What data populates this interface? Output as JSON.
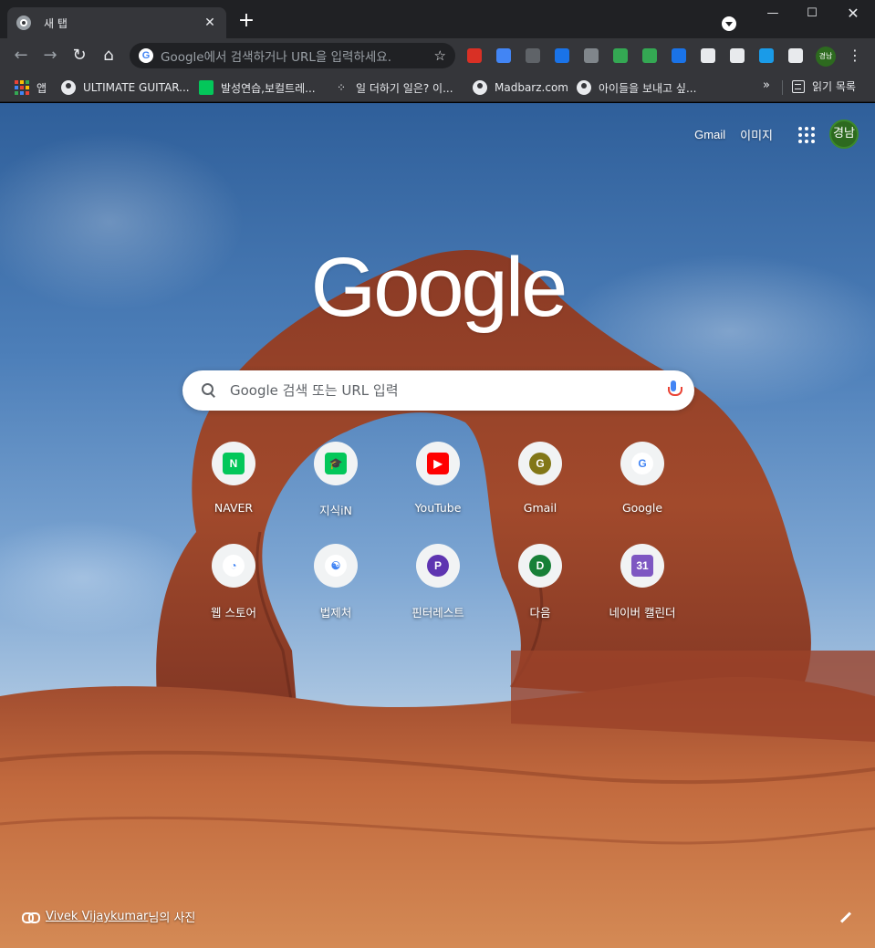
{
  "tab": {
    "title": "새 탭",
    "close": "✕",
    "new_tab": "+"
  },
  "window": {
    "minimize": "—",
    "maximize": "☐",
    "close": "✕"
  },
  "toolbar": {
    "back": "←",
    "forward": "→",
    "reload": "↻",
    "home": "⌂",
    "omnibox_placeholder": "Google에서 검색하거나 URL을 입력하세요.",
    "bookmark_star": "☆",
    "profile_label": "경남",
    "menu": "⋮",
    "extensions": [
      {
        "name": "adblock-extension",
        "color": "#d93025"
      },
      {
        "name": "translate-extension",
        "color": "#4285f4"
      },
      {
        "name": "ublock-extension",
        "color": "#5f6368"
      },
      {
        "name": "download-extension",
        "color": "#1a73e8"
      },
      {
        "name": "fx-extension",
        "color": "#80868b"
      },
      {
        "name": "check-extension",
        "color": "#34a853"
      },
      {
        "name": "screenshot-extension",
        "color": "#34a853"
      },
      {
        "name": "c-extension",
        "color": "#1a73e8"
      },
      {
        "name": "mail-extension",
        "color": "#e8eaed"
      },
      {
        "name": "ghost-extension",
        "color": "#e8eaed"
      },
      {
        "name": "todo-extension",
        "color": "#1a9be8"
      },
      {
        "name": "puzzle-extension",
        "color": "#e8eaed"
      }
    ]
  },
  "bookmarks": {
    "items": [
      {
        "label": "앱"
      },
      {
        "label": "ULTIMATE GUITAR..."
      },
      {
        "label": "발성연습,보컬트레..."
      },
      {
        "label": "일 더하기 일은? 이..."
      },
      {
        "label": "Madbarz.com"
      },
      {
        "label": "아이들을 보내고 싶..."
      }
    ],
    "overflow": "»",
    "reading_list": "읽기 목록"
  },
  "ntp": {
    "gmail": "Gmail",
    "images": "이미지",
    "avatar": "경남",
    "logo": "Google",
    "search_placeholder": "Google 검색 또는 URL 입력",
    "shortcuts": [
      {
        "label": "NAVER",
        "glyph": "N",
        "color": "#03c75a"
      },
      {
        "label": "지식iN",
        "glyph": "🎓",
        "color": "#03c75a"
      },
      {
        "label": "YouTube",
        "glyph": "▶",
        "color": "#ff0000"
      },
      {
        "label": "Gmail",
        "glyph": "G",
        "color": "#827717"
      },
      {
        "label": "Google",
        "glyph": "G",
        "color": "#ffffff"
      },
      {
        "label": "웹 스토어",
        "glyph": "◔",
        "color": "#ffffff"
      },
      {
        "label": "법제처",
        "glyph": "☯",
        "color": "#ffffff"
      },
      {
        "label": "핀터레스트",
        "glyph": "P",
        "color": "#5e35b1"
      },
      {
        "label": "다음",
        "glyph": "D",
        "color": "#188038"
      },
      {
        "label": "네이버 캘린더",
        "glyph": "31",
        "color": "#7e57c2"
      }
    ],
    "attribution_author": "Vivek Vijaykumar",
    "attribution_suffix": "님의 사진"
  }
}
